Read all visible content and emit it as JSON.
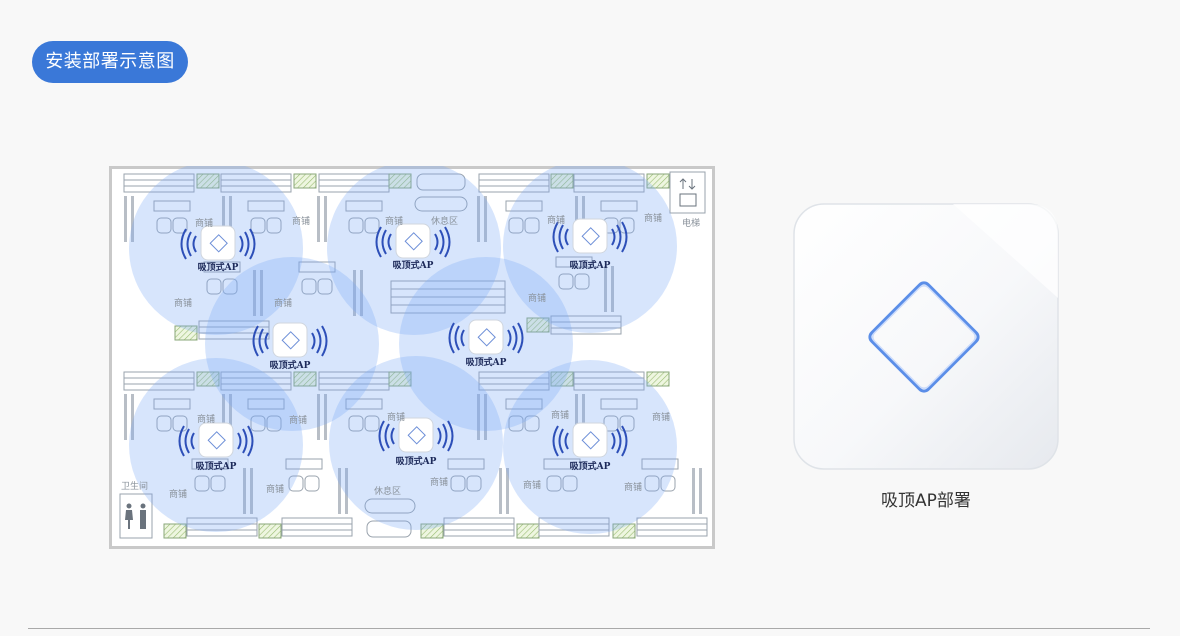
{
  "header": {
    "title": "安装部署示意图"
  },
  "floorplan": {
    "ap_label": "吸顶式AP",
    "shop_label": "商铺",
    "rest_label": "休息区",
    "elevator_label": "电梯",
    "restroom_label": "卫生间"
  },
  "device": {
    "caption": "吸顶AP部署"
  },
  "colors": {
    "accent": "#3a78d8",
    "coverage": "#7aa8f5",
    "signal": "#2d4fb8"
  },
  "icons": [
    "wifi-signal-icon",
    "elevator-icon",
    "restroom-icon",
    "diamond-logo-icon"
  ]
}
